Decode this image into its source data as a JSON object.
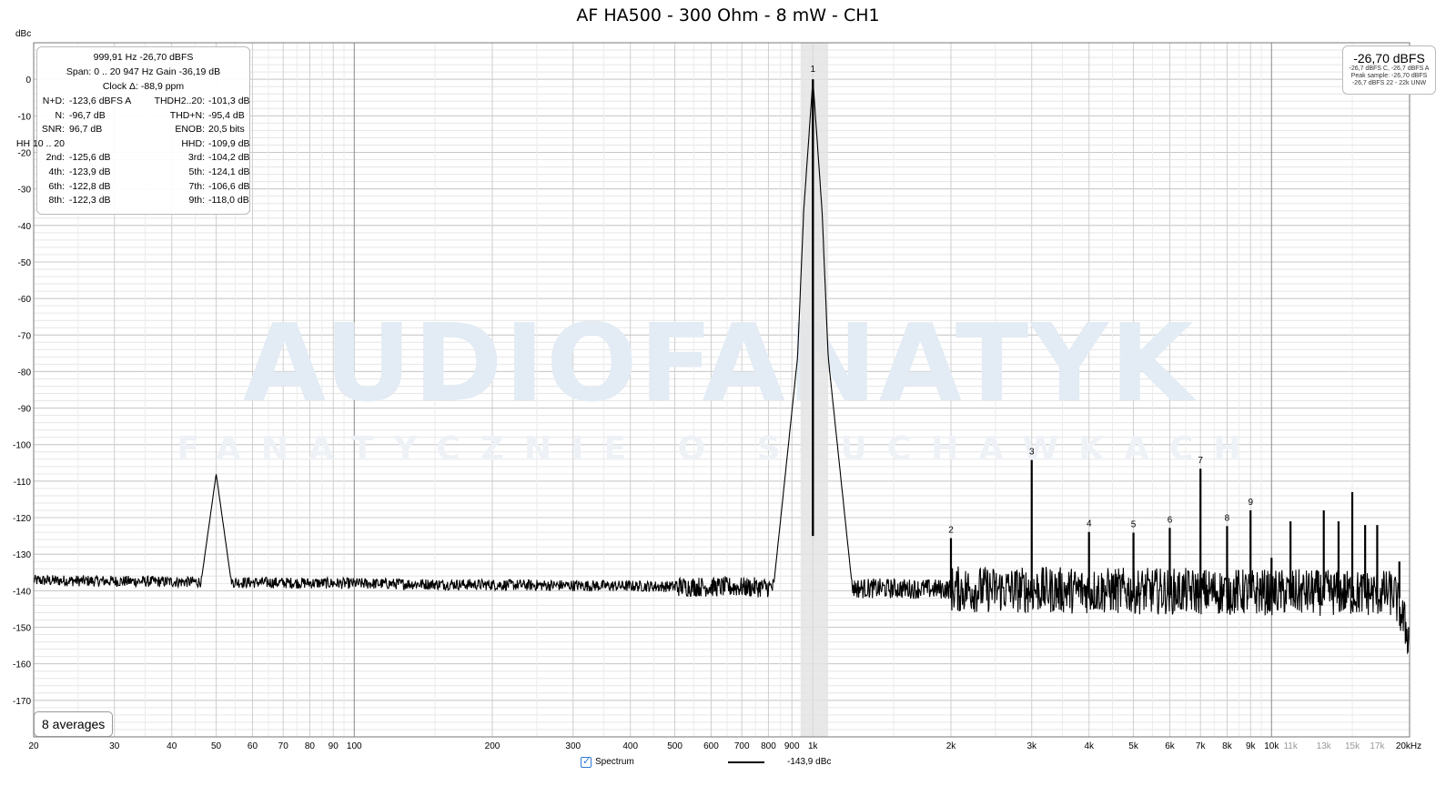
{
  "chart_data": {
    "type": "line",
    "title": "AF HA500 - 300 Ohm - 8 mW - CH1",
    "ylabel": "dBc",
    "xscale": "log",
    "xlim": [
      20,
      20000
    ],
    "ylim": [
      -180,
      10
    ],
    "grid": true,
    "y_ticks": [
      0,
      -10,
      -20,
      -30,
      -40,
      -50,
      -60,
      -70,
      -80,
      -90,
      -100,
      -110,
      -120,
      -130,
      -140,
      -150,
      -160,
      -170
    ],
    "x_ticks": [
      {
        "v": 20,
        "label": "20"
      },
      {
        "v": 30,
        "label": "30"
      },
      {
        "v": 40,
        "label": "40"
      },
      {
        "v": 50,
        "label": "50"
      },
      {
        "v": 60,
        "label": "60"
      },
      {
        "v": 70,
        "label": "70"
      },
      {
        "v": 80,
        "label": "80"
      },
      {
        "v": 90,
        "label": "90"
      },
      {
        "v": 100,
        "label": "100"
      },
      {
        "v": 200,
        "label": "200"
      },
      {
        "v": 300,
        "label": "300"
      },
      {
        "v": 400,
        "label": "400"
      },
      {
        "v": 500,
        "label": "500"
      },
      {
        "v": 600,
        "label": "600"
      },
      {
        "v": 700,
        "label": "700"
      },
      {
        "v": 800,
        "label": "800"
      },
      {
        "v": 900,
        "label": "900"
      },
      {
        "v": 1000,
        "label": "1k"
      },
      {
        "v": 2000,
        "label": "2k"
      },
      {
        "v": 3000,
        "label": "3k"
      },
      {
        "v": 4000,
        "label": "4k"
      },
      {
        "v": 5000,
        "label": "5k"
      },
      {
        "v": 6000,
        "label": "6k"
      },
      {
        "v": 7000,
        "label": "7k"
      },
      {
        "v": 8000,
        "label": "8k"
      },
      {
        "v": 9000,
        "label": "9k"
      },
      {
        "v": 10000,
        "label": "10k"
      },
      {
        "v": 11000,
        "label": "11k",
        "muted": true
      },
      {
        "v": 13000,
        "label": "13k",
        "muted": true
      },
      {
        "v": 15000,
        "label": "15k",
        "muted": true
      },
      {
        "v": 17000,
        "label": "17k",
        "muted": true
      },
      {
        "v": 20000,
        "label": "20kHz"
      }
    ],
    "series": [
      {
        "name": "Spectrum",
        "noise_floor_db": -138,
        "peaks": [
          {
            "f": 50,
            "db": -108
          },
          {
            "f": 1000,
            "db": 0
          }
        ],
        "harmonics": [
          {
            "n": "2",
            "f": 2000,
            "db": -125.6
          },
          {
            "n": "3",
            "f": 3000,
            "db": -104.2
          },
          {
            "n": "4",
            "f": 4000,
            "db": -123.9
          },
          {
            "n": "5",
            "f": 5000,
            "db": -124.1
          },
          {
            "n": "6",
            "f": 6000,
            "db": -122.8
          },
          {
            "n": "7",
            "f": 7000,
            "db": -106.6
          },
          {
            "n": "8",
            "f": 8000,
            "db": -122.3
          },
          {
            "n": "9",
            "f": 9000,
            "db": -118.0
          }
        ],
        "fundamental_label": "1",
        "extra_spurs": [
          {
            "f": 10000,
            "db": -131
          },
          {
            "f": 11000,
            "db": -121
          },
          {
            "f": 13000,
            "db": -118
          },
          {
            "f": 14000,
            "db": -121
          },
          {
            "f": 15000,
            "db": -113
          },
          {
            "f": 16000,
            "db": -122
          },
          {
            "f": 17000,
            "db": -122
          },
          {
            "f": 19000,
            "db": -132
          }
        ]
      }
    ],
    "highlight_band": [
      940,
      1080
    ],
    "watermark": {
      "main": "AUDIOFANATYK",
      "sub": "FANATYCZNIE O SŁUCHAWKACH"
    }
  },
  "stats": {
    "line1": "999,91 Hz  -26,70 dBFS",
    "line2": "Span: 0 .. 20 947 Hz   Gain -36,19 dB",
    "line3": "Clock Δ: -88,9 ppm",
    "rows": [
      {
        "l1": "N+D:",
        "v1": "-123,6 dBFS A",
        "l2": "THDH2..20:",
        "v2": "-101,3 dB"
      },
      {
        "l1": "N:",
        "v1": "-96,7 dB",
        "l2": "THD+N:",
        "v2": "-95,4 dB"
      },
      {
        "l1": "SNR:",
        "v1": "96,7 dB",
        "l2": "ENOB:",
        "v2": "20,5 bits"
      },
      {
        "l1": "HH 10 .. 20",
        "v1": "",
        "l2": "HHD:",
        "v2": "-109,9 dB"
      },
      {
        "l1": "2nd:",
        "v1": "-125,6 dB",
        "l2": "3rd:",
        "v2": "-104,2 dB"
      },
      {
        "l1": "4th:",
        "v1": "-123,9 dB",
        "l2": "5th:",
        "v2": "-124,1 dB"
      },
      {
        "l1": "6th:",
        "v1": "-122,8 dB",
        "l2": "7th:",
        "v2": "-106,6 dB"
      },
      {
        "l1": "8th:",
        "v1": "-122,3 dB",
        "l2": "9th:",
        "v2": "-118,0 dB"
      }
    ]
  },
  "level": {
    "main": "-26,70 dBFS",
    "lines": [
      "-26,7 dBFS C, -26,7 dBFS A",
      "Peak sample: -26,70 dBFS",
      "-26,7 dBFS 22 - 22k UNW"
    ]
  },
  "averages": "8 averages",
  "legend": {
    "label": "Spectrum",
    "value": "-143,9 dBc",
    "checked": "✓"
  }
}
